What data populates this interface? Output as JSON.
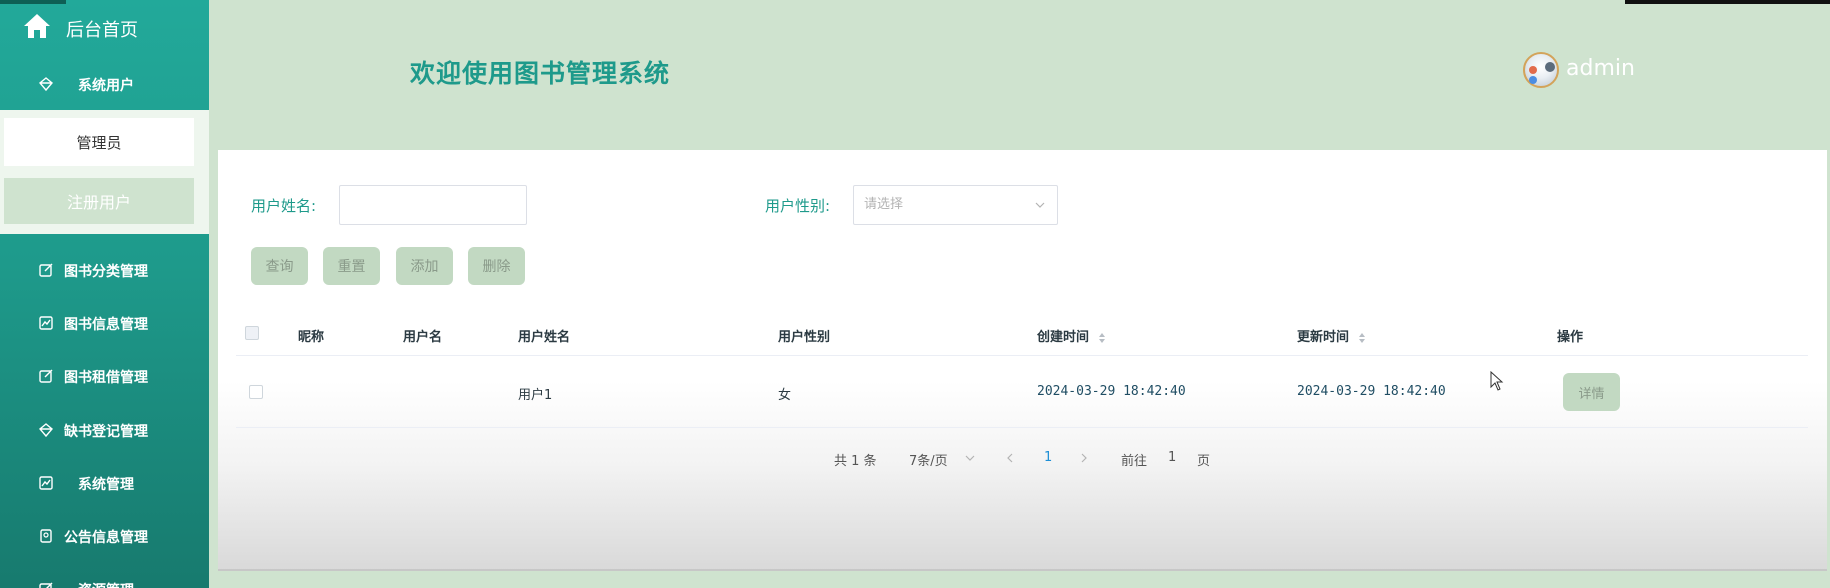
{
  "sidebar": {
    "home_label": "后台首页",
    "items": [
      {
        "label": "系统用户",
        "icon": "diamond-icon"
      },
      {
        "label": "图书分类管理",
        "icon": "edit-icon"
      },
      {
        "label": "图书信息管理",
        "icon": "chart-icon"
      },
      {
        "label": "图书租借管理",
        "icon": "edit-icon"
      },
      {
        "label": "缺书登记管理",
        "icon": "diamond-icon"
      },
      {
        "label": "系统管理",
        "icon": "chart-icon"
      },
      {
        "label": "公告信息管理",
        "icon": "badge-icon"
      },
      {
        "label": "资源管理",
        "icon": "edit-icon"
      }
    ],
    "sub_items": [
      {
        "label": "管理员"
      },
      {
        "label": "注册用户"
      }
    ]
  },
  "header": {
    "title": "欢迎使用图书管理系统",
    "username": "admin"
  },
  "search": {
    "name_label": "用户姓名:",
    "name_value": "",
    "gender_label": "用户性别:",
    "gender_placeholder": "请选择"
  },
  "toolbar": {
    "query_label": "查询",
    "reset_label": "重置",
    "add_label": "添加",
    "delete_label": "删除"
  },
  "table": {
    "columns": [
      "昵称",
      "用户名",
      "用户姓名",
      "用户性别",
      "创建时间",
      "更新时间",
      "操作"
    ],
    "rows": [
      {
        "nickname": "",
        "username": "",
        "realname": "用户1",
        "gender": "女",
        "created": "2024-03-29 18:42:40",
        "updated": "2024-03-29 18:42:40",
        "action": "详情"
      }
    ]
  },
  "pagination": {
    "total": "共 1 条",
    "page_size": "7条/页",
    "current_page": "1",
    "goto_prefix": "前往",
    "goto_value": "1",
    "goto_suffix": "页"
  },
  "colors": {
    "accent": "#1e9a8b",
    "header_bg": "#cfe3cf",
    "button_bg": "#c2d9c2"
  }
}
